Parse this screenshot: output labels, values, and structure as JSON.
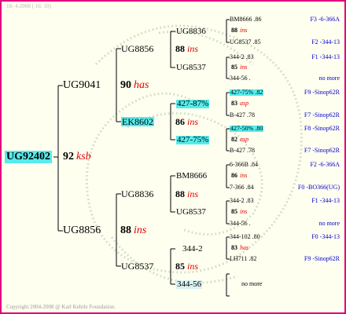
{
  "header": "18- 4-2008 ( 16: 10)",
  "footer": "Copyright 2004-2008 @ Karl Kehrle Foundation.",
  "root": {
    "name": "UG92402"
  },
  "root_result": {
    "num": "92",
    "sfx": "ksb"
  },
  "sire": {
    "name": "UG9041",
    "num": "90",
    "sfx": "has"
  },
  "dam": {
    "name": "UG8856",
    "num": "88",
    "sfx": "ins"
  },
  "ss": {
    "name": "UG8856",
    "num": "88",
    "sfx": "ins"
  },
  "sd": {
    "name": "EK8602",
    "num": "86",
    "sfx": "ins"
  },
  "ds": {
    "name": "UG8836",
    "num": "88",
    "sfx": "ins"
  },
  "dd": {
    "name": "UG8537",
    "num": "85",
    "sfx": "ins"
  },
  "sss": {
    "name": "UG8836",
    "num": "88",
    "sfx": "ins"
  },
  "ssd": {
    "name": "UG8537",
    "num": "85",
    "sfx": "ins"
  },
  "sds": {
    "name": "427-87%",
    "num": "83",
    "sfx": "asp"
  },
  "sdd": {
    "name": "427-75%",
    "num": "82",
    "sfx": "asp"
  },
  "dss": {
    "name": "BM8666",
    "num": "86",
    "sfx": "ins"
  },
  "dsd": {
    "name": "UG8537",
    "num": "85",
    "sfx": "ins"
  },
  "dds": {
    "name": "344-2",
    "num": "83",
    "sfx": "has"
  },
  "ddd": {
    "name": "344-56",
    "num": "",
    "sfx": ""
  },
  "g4": [
    {
      "name": "BM8666 .86",
      "loc": "F3 -6-366A"
    },
    {
      "name": "UG8537 .85",
      "loc": "F2 -344-13"
    },
    {
      "name": "344-2 .83",
      "loc": "F1 -344-13"
    },
    {
      "name": "344-56 .",
      "loc": "no more"
    },
    {
      "name": "427-75% .82",
      "loc": "F9 -Sinop62R"
    },
    {
      "name": "B-427 .78",
      "loc": "F7 -Sinop62R"
    },
    {
      "name": "427-50% .80",
      "loc": "F8 -Sinop62R"
    },
    {
      "name": "B-427 .78",
      "loc": "F7 -Sinop62R"
    },
    {
      "name": "6-366B .84",
      "loc": "F2 -6-366A"
    },
    {
      "name": "7-366 .84",
      "loc": "F0 -BO366(UG)"
    },
    {
      "name": "344-2 .83",
      "loc": "F1 -344-13"
    },
    {
      "name": "344-56 .",
      "loc": "no more"
    },
    {
      "name": "344-102 .80",
      "loc": "F0 -344-13"
    },
    {
      "name": "LH711 .82",
      "loc": "F9 -Sinop62R"
    },
    {
      "name": "",
      "loc": "no more"
    }
  ]
}
